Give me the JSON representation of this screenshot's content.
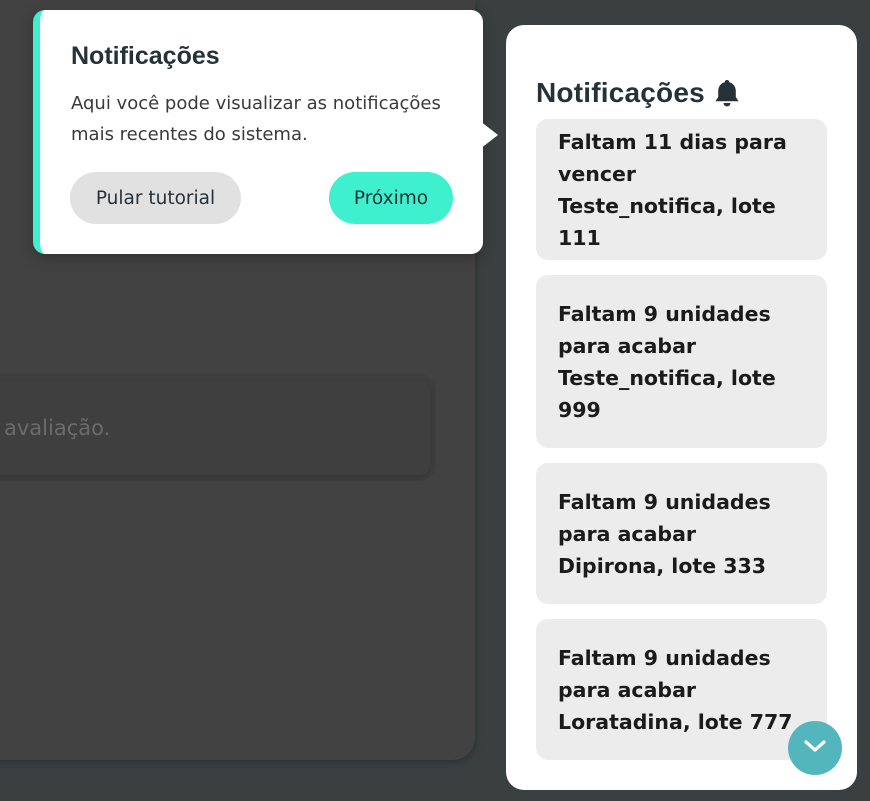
{
  "background": {
    "field_text": "avaliação."
  },
  "panel": {
    "title": "Notificações",
    "title_icon": "bell-icon",
    "notifications": [
      {
        "text": "Faltam 11 dias para vencer Teste_notifica, lote 111"
      },
      {
        "text": "Faltam 9 unidades para acabar Teste_notifica, lote 999"
      },
      {
        "text": "Faltam 9 unidades para acabar Dipirona, lote 333"
      },
      {
        "text": "Faltam 9 unidades para acabar Loratadina, lote 777"
      }
    ],
    "scroll_button_icon": "chevron-down-icon"
  },
  "tutorial": {
    "title": "Notificações",
    "body": "Aqui você pode visualizar as notificações mais recentes do sistema.",
    "skip_label": "Pular tutorial",
    "next_label": "Próximo"
  },
  "colors": {
    "accent": "#3ef0cd",
    "scroll_button": "#53b6bd",
    "overlay": "#3a3f3f",
    "card": "#ececec"
  }
}
